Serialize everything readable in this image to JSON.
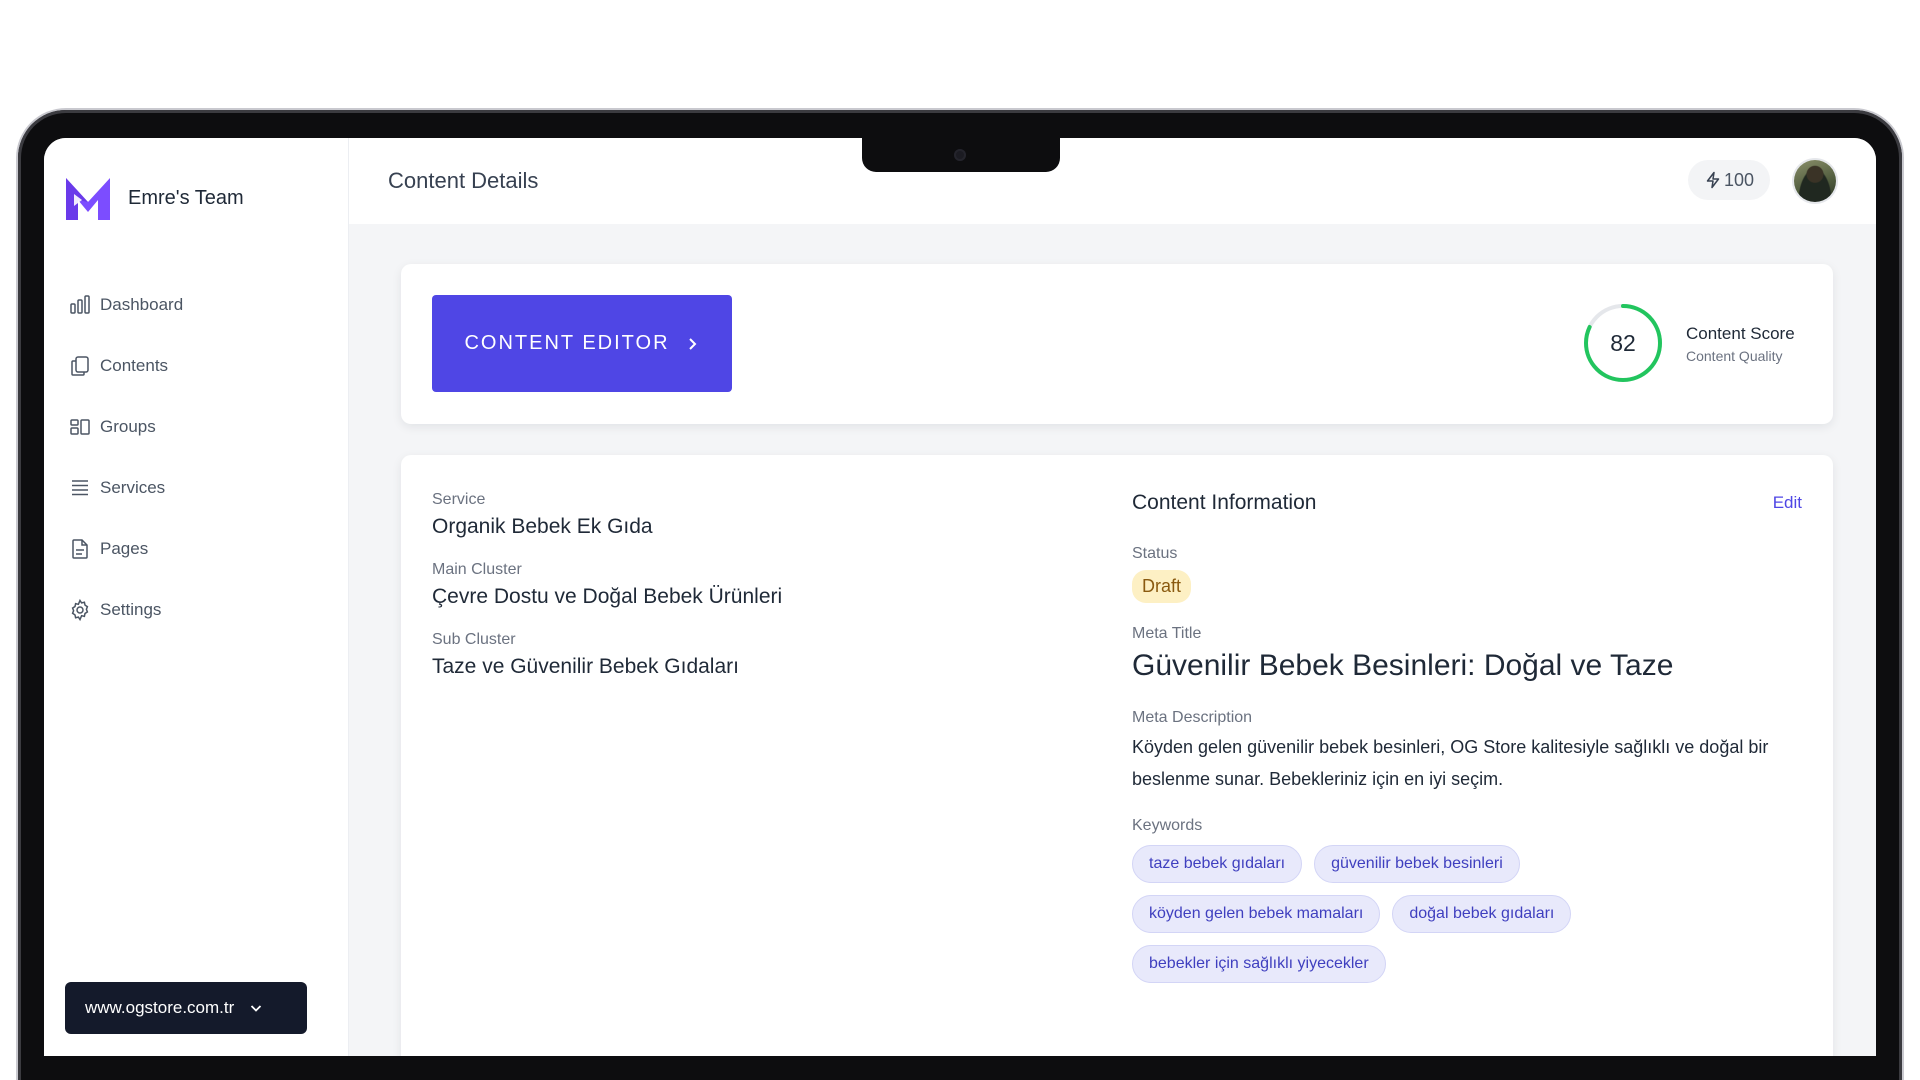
{
  "team": {
    "name": "Emre's Team",
    "logo": "m-logo-icon"
  },
  "sidebar": {
    "items": [
      {
        "label": "Dashboard",
        "icon": "bar-chart-icon"
      },
      {
        "label": "Contents",
        "icon": "documents-icon"
      },
      {
        "label": "Groups",
        "icon": "groups-icon"
      },
      {
        "label": "Services",
        "icon": "list-icon"
      },
      {
        "label": "Pages",
        "icon": "page-icon"
      },
      {
        "label": "Settings",
        "icon": "gear-icon"
      }
    ],
    "domain": "www.ogstore.com.tr"
  },
  "header": {
    "title": "Content Details",
    "credits": "100"
  },
  "editor": {
    "button_label": "CONTENT EDITOR"
  },
  "score": {
    "value": "82",
    "fraction": 0.82,
    "title": "Content Score",
    "subtitle": "Content Quality",
    "color": "#22c55e"
  },
  "details": {
    "service_label": "Service",
    "service": "Organik Bebek Ek Gıda",
    "main_cluster_label": "Main Cluster",
    "main_cluster": "Çevre Dostu ve Doğal Bebek Ürünleri",
    "sub_cluster_label": "Sub Cluster",
    "sub_cluster": "Taze ve Güvenilir Bebek Gıdaları"
  },
  "info": {
    "title": "Content Information",
    "edit_label": "Edit",
    "status_label": "Status",
    "status": "Draft",
    "meta_title_label": "Meta Title",
    "meta_title": "Güvenilir Bebek Besinleri: Doğal ve Taze",
    "meta_description_label": "Meta Description",
    "meta_description": "Köyden gelen güvenilir bebek besinleri, OG Store kalitesiyle sağlıklı ve doğal bir beslenme sunar. Bebekleriniz için en iyi seçim.",
    "keywords_label": "Keywords",
    "keywords": [
      "taze bebek gıdaları",
      "güvenilir bebek besinleri",
      "köyden gelen bebek mamaları",
      "doğal bebek gıdaları",
      "bebekler için sağlıklı yiyecekler"
    ]
  },
  "colors": {
    "accent": "#4f46e5",
    "sidebar_dark": "#141a2b",
    "score_green": "#22c55e"
  }
}
